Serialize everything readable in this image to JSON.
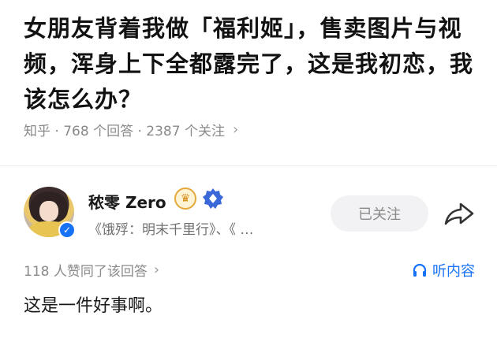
{
  "question": {
    "title": "女朋友背着我做「福利姬」，售卖图片与视频，浑身上下全都露完了，这是我初恋，我该怎么办？",
    "meta": "知乎 · 768 个回答 · 2387 个关注"
  },
  "author": {
    "name": "秾零 Zero",
    "description": "《饿殍：明末千里行》、《 …",
    "follow_label": "已关注"
  },
  "answer": {
    "votes": "118 人赞同了该回答",
    "listen_label": "听内容",
    "text": "这是一件好事啊。"
  },
  "icons": {
    "meta_chevron": "chevron-right-icon",
    "verified": "verified-badge-icon",
    "crown": "crown-badge-icon",
    "gem": "diamond-badge-icon",
    "share": "share-icon",
    "headphones": "headphones-icon"
  },
  "colors": {
    "accent_blue": "#1772f6",
    "muted_gray": "#8a8a8a",
    "badge_gold": "#e4a93a"
  }
}
